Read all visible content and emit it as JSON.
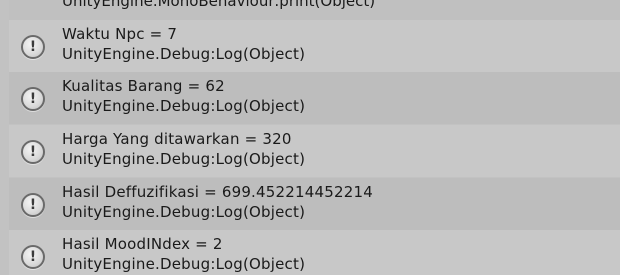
{
  "console": {
    "partial_entry": {
      "trace": "UnityEngine.MonoBehaviour:print(Object)"
    },
    "entries": [
      {
        "icon": "info-icon",
        "message": "Waktu Npc = 7",
        "trace": "UnityEngine.Debug:Log(Object)"
      },
      {
        "icon": "info-icon",
        "message": "Kualitas Barang = 62",
        "trace": "UnityEngine.Debug:Log(Object)"
      },
      {
        "icon": "info-icon",
        "message": "Harga Yang ditawarkan = 320",
        "trace": "UnityEngine.Debug:Log(Object)"
      },
      {
        "icon": "info-icon",
        "message": "Hasil Deffuzifikasi = 699.452214452214",
        "trace": "UnityEngine.Debug:Log(Object)"
      },
      {
        "icon": "info-icon",
        "message": "Hasil MoodINdex = 2",
        "trace": "UnityEngine.Debug:Log(Object)"
      }
    ]
  }
}
